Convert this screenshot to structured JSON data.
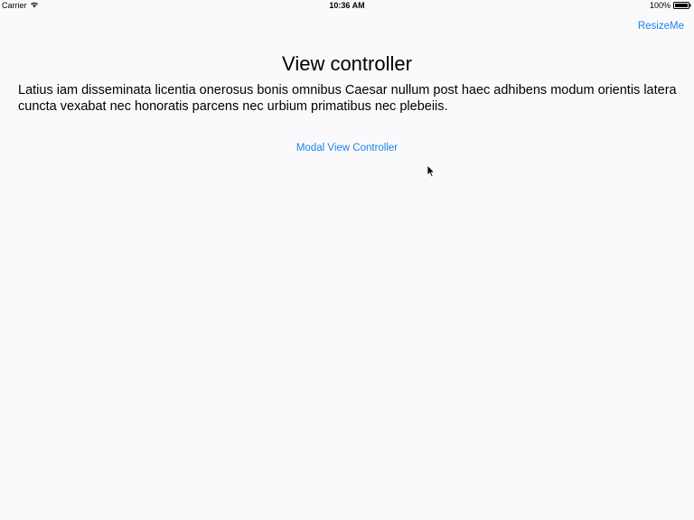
{
  "status_bar": {
    "carrier": "Carrier",
    "time": "10:36 AM",
    "battery_percent": "100%",
    "icons": [
      "wifi-icon",
      "battery-icon"
    ]
  },
  "nav": {
    "right_button": "ResizeMe"
  },
  "main": {
    "title": "View controller",
    "body": "Latius iam disseminata licentia onerosus bonis omnibus Caesar nullum post haec adhibens modum orientis latera cuncta vexabat nec honoratis parcens nec urbium primatibus nec plebeiis.",
    "modal_link": "Modal View Controller"
  },
  "colors": {
    "background": "#fafafd",
    "tint": "#1a84e8",
    "text": "#000000"
  }
}
